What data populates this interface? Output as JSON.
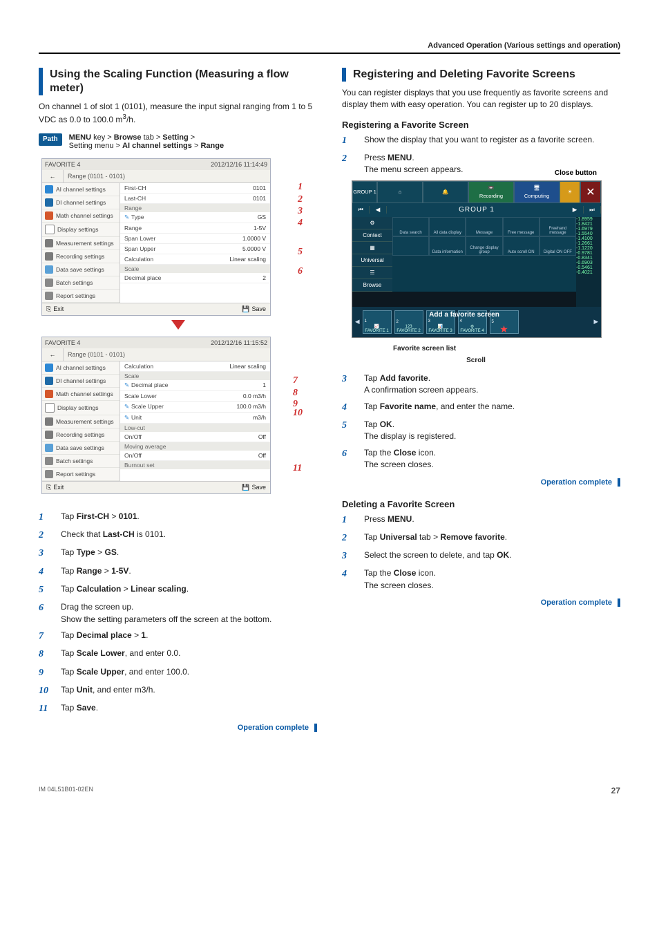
{
  "header": "Advanced Operation (Various settings and operation)",
  "left": {
    "title": "Using the Scaling Function (Measuring a flow meter)",
    "intro_a": "On channel 1 of slot 1 (0101), measure the input signal ranging from 1 to 5 VDC as 0.0 to 100.0 m",
    "intro_sup": "3",
    "intro_b": "/h.",
    "path_badge": "Path",
    "path_line1a": "MENU",
    "path_line1b": " key > ",
    "path_line1c": "Browse",
    "path_line1d": " tab > ",
    "path_line1e": "Setting",
    "path_line1f": " > ",
    "path_line2a": "Setting menu > ",
    "path_line2b": "AI channel settings",
    "path_line2c": " > ",
    "path_line2d": "Range",
    "screenshot1": {
      "titlebar": "FAVORITE 4",
      "timestamp": "2012/12/16 11:14:49",
      "crumb": "Range (0101 - 0101)",
      "exit": "Exit",
      "save": "Save",
      "sidebar": [
        "AI channel settings",
        "DI channel settings",
        "Math channel settings",
        "Display settings",
        "Measurement settings",
        "Recording settings",
        "Data save settings",
        "Batch settings",
        "Report settings"
      ],
      "rows": [
        {
          "head": "",
          "label": "First-CH",
          "val": "0101",
          "ann": "1"
        },
        {
          "head": "",
          "label": "Last-CH",
          "val": "0101",
          "ann": "2"
        },
        {
          "head": "Range",
          "label": "Type",
          "val": "GS",
          "ann": "3"
        },
        {
          "head": "",
          "label": "Range",
          "val": "1-5V",
          "ann": "4"
        },
        {
          "head": "",
          "label": "Span Lower",
          "val": "1.0000 V",
          "ann": ""
        },
        {
          "head": "",
          "label": "Span Upper",
          "val": "5.0000 V",
          "ann": ""
        },
        {
          "head": "",
          "label": "Calculation",
          "val": "Linear scaling",
          "ann": "5"
        },
        {
          "head": "Scale",
          "label": "Decimal place",
          "val": "2",
          "ann": "6"
        }
      ]
    },
    "screenshot2": {
      "titlebar": "FAVORITE 4",
      "timestamp": "2012/12/16 11:15:52",
      "crumb": "Range (0101 - 0101)",
      "exit": "Exit",
      "save": "Save",
      "sidebar": [
        "AI channel settings",
        "DI channel settings",
        "Math channel settings",
        "Display settings",
        "Measurement settings",
        "Recording settings",
        "Data save settings",
        "Batch settings",
        "Report settings"
      ],
      "rows": [
        {
          "head": "",
          "label": "Calculation",
          "val": "Linear scaling",
          "ann": ""
        },
        {
          "head": "Scale",
          "label": "Decimal place",
          "val": "1",
          "ann": "7"
        },
        {
          "head": "",
          "label": "Scale Lower",
          "val": "0.0 m3/h",
          "ann": "8"
        },
        {
          "head": "",
          "label": "Scale Upper",
          "val": "100.0 m3/h",
          "ann": "9"
        },
        {
          "head": "",
          "label": "Unit",
          "val": "m3/h",
          "ann": "10"
        },
        {
          "head": "Low-cut",
          "label": "On/Off",
          "val": "Off",
          "ann": ""
        },
        {
          "head": "Moving average",
          "label": "On/Off",
          "val": "Off",
          "ann": ""
        },
        {
          "head": "Burnout set",
          "label": "",
          "val": "",
          "ann": ""
        }
      ],
      "save_ann": "11"
    },
    "steps": [
      {
        "n": "1",
        "a": "Tap ",
        "b": "First-CH",
        "c": " > ",
        "d": "0101",
        "e": "."
      },
      {
        "n": "2",
        "a": "Check that ",
        "b": "Last-CH",
        "c": " is 0101.",
        "d": "",
        "e": ""
      },
      {
        "n": "3",
        "a": "Tap ",
        "b": "Type",
        "c": " > ",
        "d": "GS",
        "e": "."
      },
      {
        "n": "4",
        "a": "Tap ",
        "b": "Range",
        "c": " > ",
        "d": "1-5V",
        "e": "."
      },
      {
        "n": "5",
        "a": "Tap ",
        "b": "Calculation",
        "c": " > ",
        "d": "Linear scaling",
        "e": "."
      },
      {
        "n": "6",
        "a": "Drag the screen up.",
        "b": "",
        "c": "",
        "d": "",
        "e": ""
      },
      {
        "n": "",
        "a": "Show the setting parameters off the screen at the bottom.",
        "b": "",
        "c": "",
        "d": "",
        "e": ""
      },
      {
        "n": "7",
        "a": "Tap ",
        "b": "Decimal place",
        "c": " > ",
        "d": "1",
        "e": "."
      },
      {
        "n": "8",
        "a": "Tap ",
        "b": "Scale Lower",
        "c": ", and enter 0.0.",
        "d": "",
        "e": ""
      },
      {
        "n": "9",
        "a": "Tap ",
        "b": "Scale Upper",
        "c": ", and enter 100.0.",
        "d": "",
        "e": ""
      },
      {
        "n": "10",
        "a": "Tap ",
        "b": "Unit",
        "c": ", and enter m3/h.",
        "d": "",
        "e": ""
      },
      {
        "n": "11",
        "a": "Tap ",
        "b": "Save",
        "c": ".",
        "d": "",
        "e": ""
      }
    ],
    "op_complete": "Operation complete"
  },
  "right": {
    "title": "Registering and Deleting Favorite Screens",
    "intro": "You can register displays that you use frequently as favorite screens and display them with easy operation. You can register up to 20 displays.",
    "reg_head": "Registering a Favorite Screen",
    "reg_steps_top": [
      {
        "n": "1",
        "a": "Show the display that you want to register as a favorite screen.",
        "b": "",
        "c": ""
      },
      {
        "n": "2",
        "a": "Press ",
        "b": "MENU",
        "c": "."
      }
    ],
    "reg_note": "The menu screen appears.",
    "fav_annot": {
      "close": "Close button",
      "addfav": "Add a favorite screen",
      "favlist": "Favorite screen list",
      "scroll": "Scroll"
    },
    "fav_screen": {
      "group_label": "GROUP 1",
      "group_side": "GROUP 1",
      "top_home": "⌂",
      "top_buzzer": "",
      "top_recording": "Recording",
      "top_computing": "Computing",
      "context": "Context",
      "universal": "Universal",
      "browse": "Browse",
      "ctx_labels": [
        "Data search",
        "All data display",
        "Message",
        "Free message",
        "Freehand message",
        "",
        "Data information",
        "Change display group",
        "Auto scroll ON",
        "Digital ON OFF",
        ""
      ],
      "scale_values": [
        "-1.8959",
        "-1.8421",
        "-1.6979",
        "-1.5540",
        "-1.4100",
        "-1.2661",
        "-1.1220",
        "-0.9781",
        "-0.8341",
        "-0.6903",
        "-0.5461",
        "-0.4021"
      ],
      "fav_chips": [
        "FAVORITE 1",
        "FAVORITE 2",
        "FAVORITE 3",
        "FAVORITE 4",
        ""
      ]
    },
    "reg_steps_bottom": [
      {
        "n": "3",
        "a": "Tap ",
        "b": "Add favorite",
        "c": "."
      },
      {
        "n": "",
        "a": "A confirmation screen appears.",
        "b": "",
        "c": ""
      },
      {
        "n": "4",
        "a": "Tap ",
        "b": "Favorite name",
        "c": ", and enter the name."
      },
      {
        "n": "5",
        "a": "Tap ",
        "b": "OK",
        "c": "."
      },
      {
        "n": "",
        "a": "The display is registered.",
        "b": "",
        "c": ""
      },
      {
        "n": "6",
        "a": "Tap the ",
        "b": "Close",
        "c": " icon."
      },
      {
        "n": "",
        "a": "The screen closes.",
        "b": "",
        "c": ""
      }
    ],
    "op_complete": "Operation complete",
    "del_head": "Deleting a Favorite Screen",
    "del_steps": [
      {
        "n": "1",
        "a": "Press ",
        "b": "MENU",
        "c": ".",
        "d": "",
        "e": ""
      },
      {
        "n": "2",
        "a": "Tap ",
        "b": "Universal",
        "c": " tab > ",
        "d": "Remove favorite",
        "e": "."
      },
      {
        "n": "3",
        "a": "Select the screen to delete, and tap ",
        "b": "OK",
        "c": ".",
        "d": "",
        "e": ""
      },
      {
        "n": "4",
        "a": "Tap the ",
        "b": "Close",
        "c": " icon.",
        "d": "",
        "e": ""
      },
      {
        "n": "",
        "a": "The screen closes.",
        "b": "",
        "c": "",
        "d": "",
        "e": ""
      }
    ]
  },
  "footer": {
    "code": "IM 04L51B01-02EN",
    "page": "27"
  }
}
